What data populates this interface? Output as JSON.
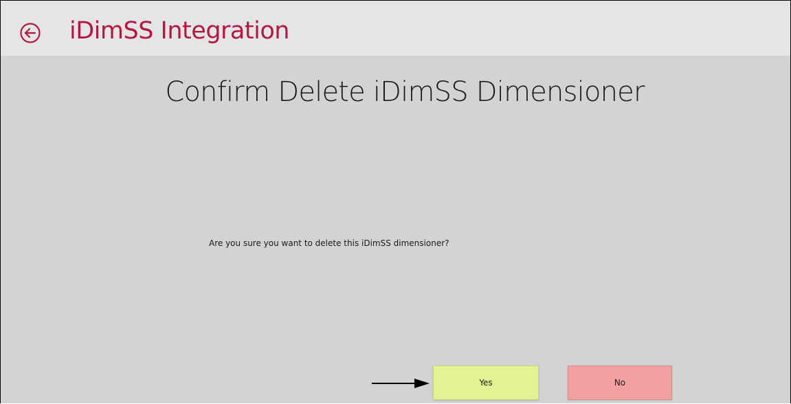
{
  "header": {
    "back_icon": "back-arrow-circle-icon",
    "title": "iDimSS Integration"
  },
  "main": {
    "page_title": "Confirm Delete iDimSS Dimensioner",
    "message": "Are you sure you want to delete this iDimSS dimensioner?",
    "yes_label": "Yes",
    "no_label": "No"
  },
  "colors": {
    "accent": "#b3193f",
    "header_bg": "#e5e5e7",
    "content_bg": "#d3d3d3",
    "yes_button": "#e2f394",
    "no_button": "#f2a0a0"
  },
  "annotation": {
    "arrow_icon": "pointer-arrow-icon"
  }
}
